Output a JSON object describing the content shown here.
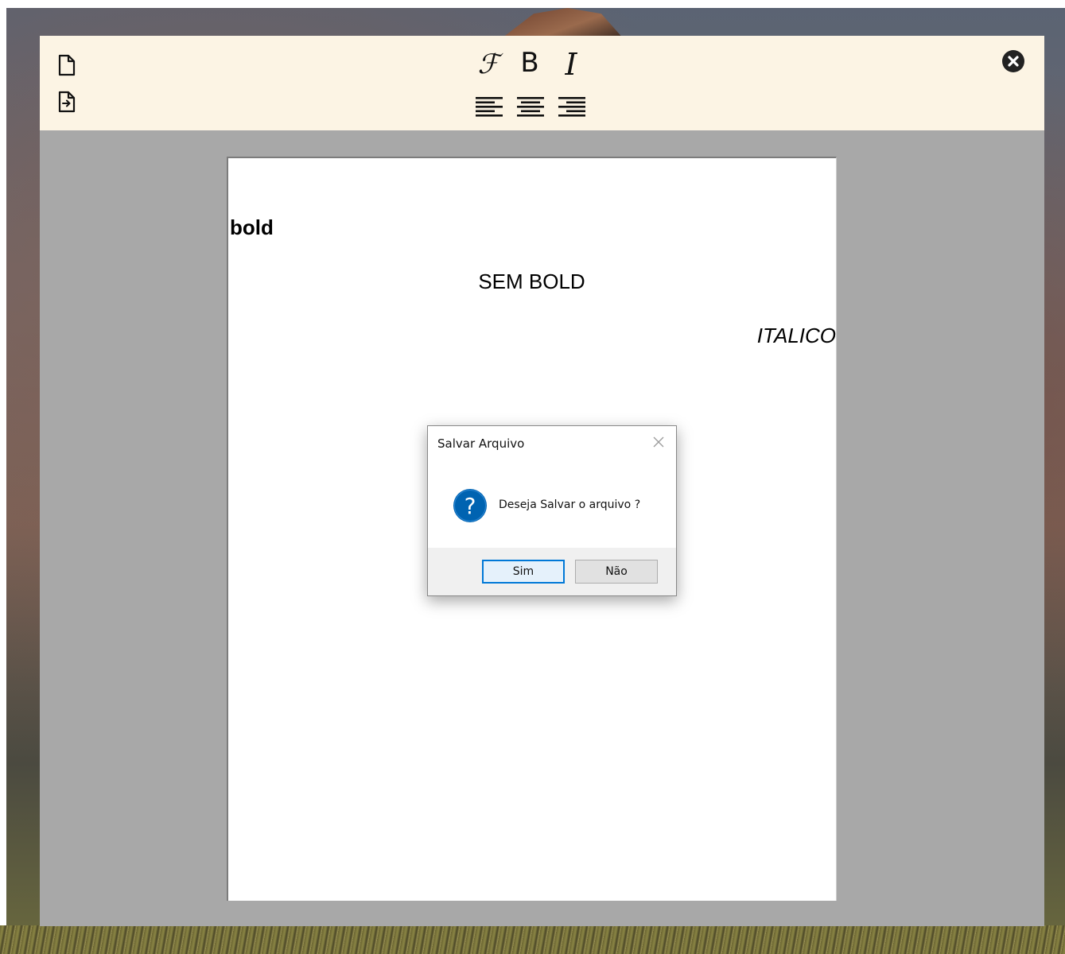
{
  "toolbar": {
    "font_glyph": "ℱ",
    "bold_glyph": "B",
    "italic_glyph": "I"
  },
  "document": {
    "lines": [
      {
        "text": "bold",
        "style": "bold",
        "align": "left"
      },
      {
        "text": "SEM BOLD",
        "style": "normal",
        "align": "center"
      },
      {
        "text": "ITALICO",
        "style": "italic",
        "align": "right"
      }
    ]
  },
  "dialog": {
    "title": "Salvar Arquivo",
    "icon": "question-icon",
    "message": "Deseja Salvar o arquivo ?",
    "yes_label": "Sim",
    "no_label": "Não"
  },
  "colors": {
    "toolbar_bg": "#fcf4e4",
    "workspace_bg": "#a8a8a8",
    "dialog_accent": "#0078d7",
    "question_icon": "#0063b1"
  },
  "icons": [
    "new-file-icon",
    "export-file-icon",
    "font-icon",
    "bold-icon",
    "italic-icon",
    "align-left-icon",
    "align-center-icon",
    "align-right-icon",
    "close-circle-icon",
    "close-icon",
    "question-icon"
  ]
}
